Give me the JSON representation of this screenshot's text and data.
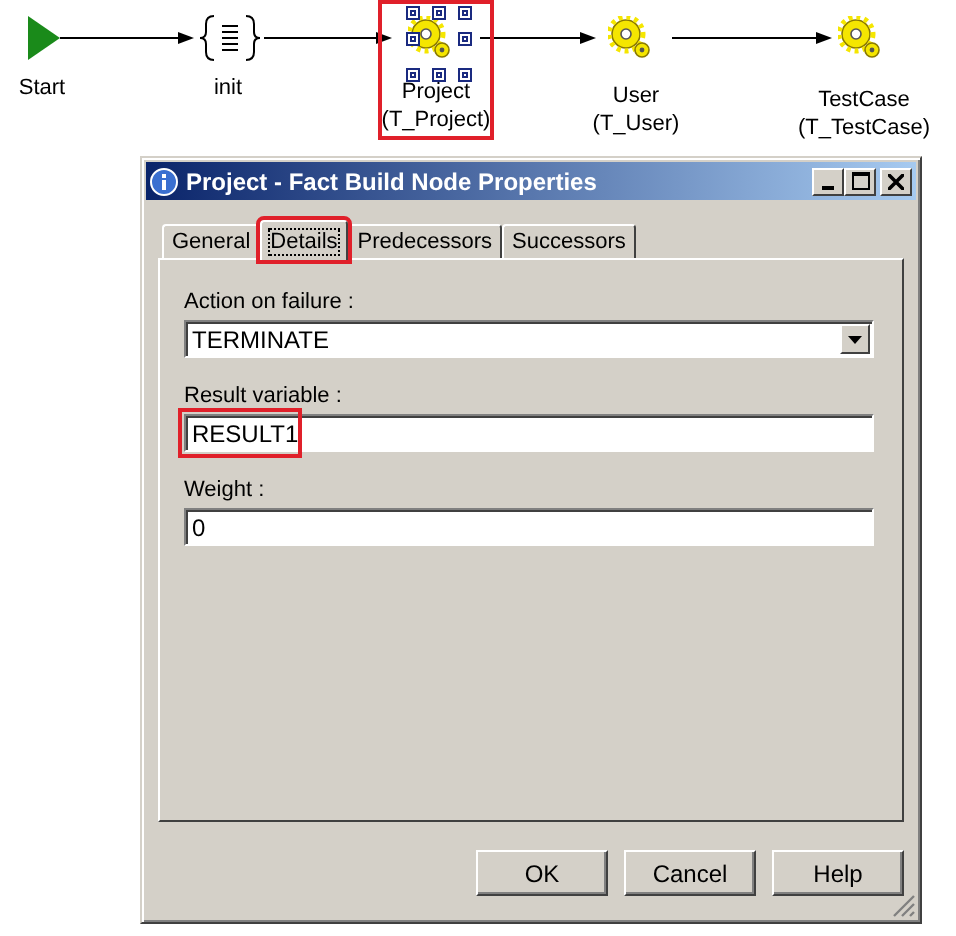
{
  "diagram": {
    "nodes": [
      {
        "kind": "start",
        "label": "Start",
        "selected": false,
        "highlighted": false
      },
      {
        "kind": "script",
        "label": "init",
        "selected": false,
        "highlighted": false
      },
      {
        "kind": "task",
        "label": "Project",
        "type_label": "(T_Project)",
        "selected": true,
        "highlighted": true
      },
      {
        "kind": "task",
        "label": "User",
        "type_label": "(T_User)",
        "selected": false,
        "highlighted": false
      },
      {
        "kind": "task",
        "label": "TestCase",
        "type_label": "(T_TestCase)",
        "selected": false,
        "highlighted": false
      }
    ]
  },
  "dialog": {
    "title": "Project - Fact Build Node Properties",
    "tabs": [
      {
        "label": "General",
        "selected": false,
        "highlighted": false
      },
      {
        "label": "Details",
        "selected": true,
        "highlighted": true
      },
      {
        "label": "Predecessors",
        "selected": false,
        "highlighted": false
      },
      {
        "label": "Successors",
        "selected": false,
        "highlighted": false
      }
    ],
    "fields": [
      {
        "kind": "dropdown",
        "label": "Action on failure :",
        "value": "TERMINATE",
        "highlighted": false
      },
      {
        "kind": "text",
        "label": "Result variable :",
        "value": "RESULT1",
        "highlighted": true
      },
      {
        "kind": "text",
        "label": "Weight :",
        "value": "0",
        "highlighted": false
      }
    ],
    "buttons": [
      "OK",
      "Cancel",
      "Help"
    ]
  }
}
